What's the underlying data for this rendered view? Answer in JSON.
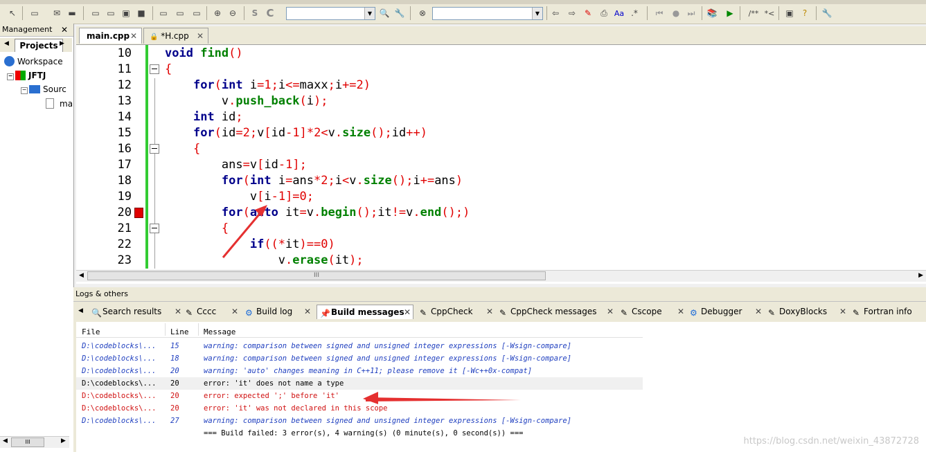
{
  "toolbar": {
    "icons": [
      "cursor-icon",
      "rect-icon",
      "envelope-icon",
      "dash-icon",
      "rect-fill-icon",
      "block-icon",
      "box-icon",
      "box2-icon",
      "box3-icon",
      "zoom-in-icon",
      "zoom-out-icon",
      "s-icon",
      "c-icon",
      "search-icon",
      "wrench-icon",
      "close-circle-icon",
      "back-icon",
      "forward-icon",
      "highlight-icon",
      "mark-icon",
      "font-icon",
      "regex-icon",
      "prev-icon",
      "dot-icon",
      "next-icon",
      "book-icon",
      "run-icon",
      "comment-icon",
      "uncomment-icon",
      "window-icon",
      "help-icon",
      "tools-icon"
    ],
    "symbols": {
      "s": "S",
      "c": "C",
      "aa": "Aa",
      "comment": "/**",
      "uncomment": "*<"
    }
  },
  "management": {
    "title": "Management",
    "tab_label": "Projects",
    "tree": [
      {
        "label": "Workspace"
      },
      {
        "label": "JFTJ"
      },
      {
        "label": "Sourc"
      },
      {
        "label": "ma"
      }
    ]
  },
  "editor": {
    "tabs": [
      {
        "label": "main.cpp",
        "active": true
      },
      {
        "label": "*H.cpp",
        "active": false
      }
    ],
    "close_glyph": "✕",
    "line_numbers": [
      "10",
      "11",
      "12",
      "13",
      "14",
      "15",
      "16",
      "17",
      "18",
      "19",
      "20",
      "21",
      "22",
      "23"
    ],
    "scroll_grip": "III"
  },
  "logs": {
    "title": "Logs & others",
    "tabs": [
      {
        "label": "Search results"
      },
      {
        "label": "Cccc"
      },
      {
        "label": "Build log"
      },
      {
        "label": "Build messages",
        "active": true
      },
      {
        "label": "CppCheck"
      },
      {
        "label": "CppCheck messages"
      },
      {
        "label": "Cscope"
      },
      {
        "label": "Debugger"
      },
      {
        "label": "DoxyBlocks"
      },
      {
        "label": "Fortran info"
      }
    ],
    "columns": {
      "file": "File",
      "line": "Line",
      "message": "Message"
    },
    "rows": [
      {
        "file": "D:\\codeblocks\\...",
        "line": "15",
        "message": "warning: comparison between signed and unsigned integer expressions [-Wsign-compare]",
        "kind": "warn"
      },
      {
        "file": "D:\\codeblocks\\...",
        "line": "18",
        "message": "warning: comparison between signed and unsigned integer expressions [-Wsign-compare]",
        "kind": "warn"
      },
      {
        "file": "D:\\codeblocks\\...",
        "line": "20",
        "message": "warning: 'auto' changes meaning in C++11; please remove it [-Wc++0x-compat]",
        "kind": "warn"
      },
      {
        "file": "D:\\codeblocks\\...",
        "line": "20",
        "message": "error: 'it' does not name a type",
        "kind": "plain"
      },
      {
        "file": "D:\\codeblocks\\...",
        "line": "20",
        "message": "error: expected ';' before 'it'",
        "kind": "err"
      },
      {
        "file": "D:\\codeblocks\\...",
        "line": "20",
        "message": "error: 'it' was not declared in this scope",
        "kind": "err"
      },
      {
        "file": "D:\\codeblocks\\...",
        "line": "27",
        "message": "warning: comparison between signed and unsigned integer expressions [-Wsign-compare]",
        "kind": "warn"
      },
      {
        "file": "",
        "line": "",
        "message": "=== Build failed: 3 error(s), 4 warning(s) (0 minute(s), 0 second(s)) ===",
        "kind": "plain"
      }
    ]
  },
  "watermark": "https://blog.csdn.net/weixin_43872728",
  "colors": {
    "keyword": "#00008b",
    "function": "#008000",
    "operator": "#e00000",
    "warning": "#1f3fbf",
    "error": "#d01010",
    "changebar": "#33cc33"
  }
}
